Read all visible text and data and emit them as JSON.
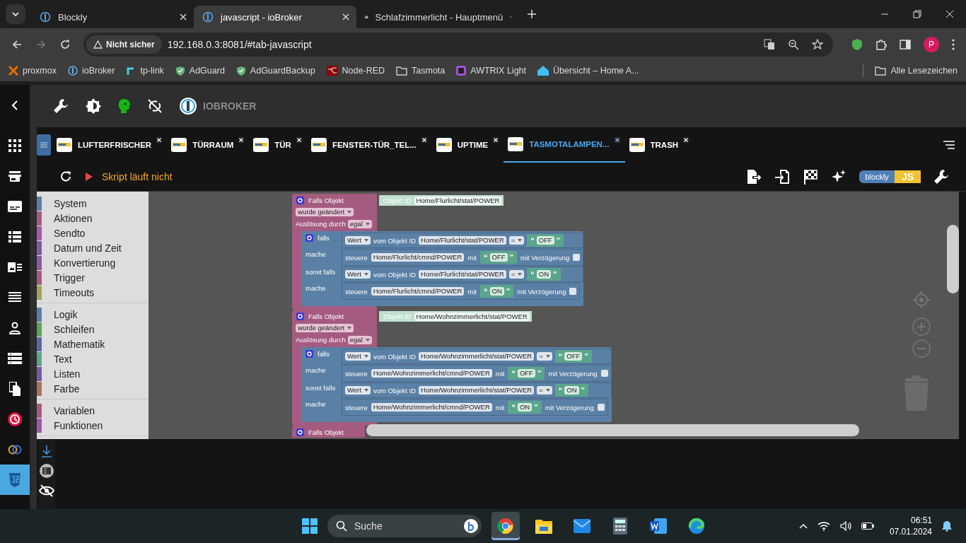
{
  "browser": {
    "tabs": [
      {
        "title": "Blockly",
        "selected": false
      },
      {
        "title": "javascript - ioBroker",
        "selected": true
      },
      {
        "title": "Schlafzimmerlicht - Hauptmenü",
        "selected": false
      }
    ],
    "security": "Nicht sicher",
    "url": "192.168.0.3:8081/#tab-javascript",
    "profile": "P",
    "bookmarks": [
      "proxmox",
      "ioBroker",
      "tp-link",
      "AdGuard",
      "AdGuardBackup",
      "Node-RED",
      "Tasmota",
      "AWTRIX Light",
      "Übersicht – Home A..."
    ],
    "all_bookmarks": "Alle Lesezeichen"
  },
  "app": {
    "brand": "IOBROKER",
    "nav": [
      {
        "selected": false
      },
      {
        "selected": false
      },
      {
        "selected": false
      },
      {
        "selected": false
      },
      {
        "selected": false
      },
      {
        "selected": false
      },
      {
        "selected": false
      },
      {
        "selected": false
      },
      {
        "selected": false
      },
      {
        "selected": false
      },
      {
        "selected": false
      },
      {
        "selected": true
      }
    ],
    "script_tabs": [
      {
        "label": "LUFTERFRISCHER",
        "selected": false
      },
      {
        "label": "TÜRRAUM",
        "selected": false
      },
      {
        "label": "TÜR",
        "selected": false
      },
      {
        "label": "FENSTER-TÜR_TEL...",
        "selected": false
      },
      {
        "label": "UPTIME",
        "selected": false
      },
      {
        "label": "TASMOTALAMPEN...",
        "selected": true
      },
      {
        "label": "TRASH",
        "selected": false
      }
    ],
    "status": "Skript läuft nicht",
    "editor_toggle": {
      "blockly": "blockly",
      "js": "JS"
    },
    "toolbox": [
      {
        "items": [
          {
            "label": "System",
            "color": "#5b80a5"
          },
          {
            "label": "Aktionen",
            "color": "#a55b80"
          },
          {
            "label": "Sendto",
            "color": "#a55ba5"
          },
          {
            "label": "Datum und Zeit",
            "color": "#805ba5"
          },
          {
            "label": "Konvertierung",
            "color": "#8a5ba5"
          },
          {
            "label": "Trigger",
            "color": "#a55b80"
          },
          {
            "label": "Timeouts",
            "color": "#9fa55b"
          }
        ]
      },
      {
        "items": [
          {
            "label": "Logik",
            "color": "#5b80a5"
          },
          {
            "label": "Schleifen",
            "color": "#5ba55b"
          },
          {
            "label": "Mathematik",
            "color": "#5b67a5"
          },
          {
            "label": "Text",
            "color": "#5ba58c"
          },
          {
            "label": "Listen",
            "color": "#745ba5"
          },
          {
            "label": "Farbe",
            "color": "#a5745b"
          }
        ]
      },
      {
        "items": [
          {
            "label": "Variablen",
            "color": "#a55b80"
          },
          {
            "label": "Funktionen",
            "color": "#995ba5"
          }
        ]
      }
    ],
    "quote_marks": {
      "open": "“",
      "close": "”"
    },
    "blocks": [
      {
        "title": "Falls Objekt",
        "id_label": "Objekt ID",
        "object_id": "Home/Flurlicht/stat/POWER",
        "event": "wurde geändert",
        "trigger_label": "Auslösung durch",
        "trigger": "egal",
        "branches": [
          {
            "if_label": "falls",
            "value": "Wert",
            "value_from": "vom Objekt ID",
            "cond_id": "Home/Flurlicht/stat/POWER",
            "op": "=",
            "compare": "OFF",
            "do_label": "mache",
            "verb": "steuere",
            "target": "Home/Flurlicht/cmnd/POWER",
            "with": "mit",
            "set": "OFF",
            "delay_label": "mit Verzögerung",
            "delay": false
          },
          {
            "if_label": "sonst falls",
            "value": "Wert",
            "value_from": "vom Objekt ID",
            "cond_id": "Home/Flurlicht/stat/POWER",
            "op": "=",
            "compare": "ON",
            "do_label": "mache",
            "verb": "steuere",
            "target": "Home/Flurlicht/cmnd/POWER",
            "with": "mit",
            "set": "ON",
            "delay_label": "mit Verzögerung",
            "delay": false
          }
        ]
      },
      {
        "title": "Falls Objekt",
        "id_label": "Objekt ID",
        "object_id": "Home/Wohnzimmerlicht/stat/POWER",
        "event": "wurde geändert",
        "trigger_label": "Auslösung durch",
        "trigger": "egal",
        "branches": [
          {
            "if_label": "falls",
            "value": "Wert",
            "value_from": "vom Objekt ID",
            "cond_id": "Home/Wohnzimmerlicht/stat/POWER",
            "op": "=",
            "compare": "OFF",
            "do_label": "mache",
            "verb": "steuere",
            "target": "Home/Wohnzimmerlicht/cmnd/POWER",
            "with": "mit",
            "set": "OFF",
            "delay_label": "mit Verzögerung",
            "delay": false
          },
          {
            "if_label": "sonst falls",
            "value": "Wert",
            "value_from": "vom Objekt ID",
            "cond_id": "Home/Wohnzimmerlicht/stat/POWER",
            "op": "=",
            "compare": "ON",
            "do_label": "mache",
            "verb": "steuere",
            "target": "Home/Wohnzimmerlicht/cmnd/POWER",
            "with": "mit",
            "set": "ON",
            "delay_label": "mit Verzögerung",
            "delay": false
          }
        ]
      },
      {
        "title": "Falls Objekt"
      }
    ]
  },
  "taskbar": {
    "search": "Suche",
    "apps": [
      {
        "selected": true
      },
      {
        "selected": false
      },
      {
        "selected": false
      },
      {
        "selected": false
      },
      {
        "selected": false
      },
      {
        "selected": false
      }
    ],
    "time": "06:51",
    "date": "07.01.2024"
  }
}
